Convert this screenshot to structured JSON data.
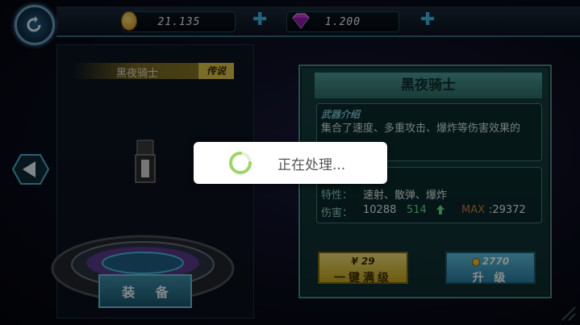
{
  "resources": {
    "coins": "21.135",
    "gems": "1.200"
  },
  "item": {
    "name": "黑夜骑士",
    "rank": "传说",
    "equip_label": "装 备"
  },
  "detail": {
    "title": "黑夜骑士",
    "intro_header": "武器介绍",
    "intro_text": "集合了速度、多重攻击、爆炸等伤害效果的",
    "traits_label": "特性：",
    "traits_value": "速射、散弹、爆炸",
    "damage_label": "伤害：",
    "damage_value": "10288",
    "damage_bonus": "514",
    "max_label": "MAX",
    "max_value": ":29372"
  },
  "buttons": {
    "upgrade_all_cost": "¥ 29",
    "upgrade_all_label": "一键满级",
    "upgrade_cost": "2770",
    "upgrade_label": "升 级"
  },
  "loading": {
    "text": "正在处理..."
  },
  "colors": {
    "accent": "#3fb6e8",
    "gold": "#e1c64a",
    "panel": "#16403f",
    "max": "#d07a3a",
    "bonus": "#66e08a"
  },
  "icons": [
    "back-icon",
    "coin-icon",
    "gem-icon",
    "plus-icon",
    "arrow-left-icon",
    "spinner-icon",
    "up-arrow-icon"
  ]
}
